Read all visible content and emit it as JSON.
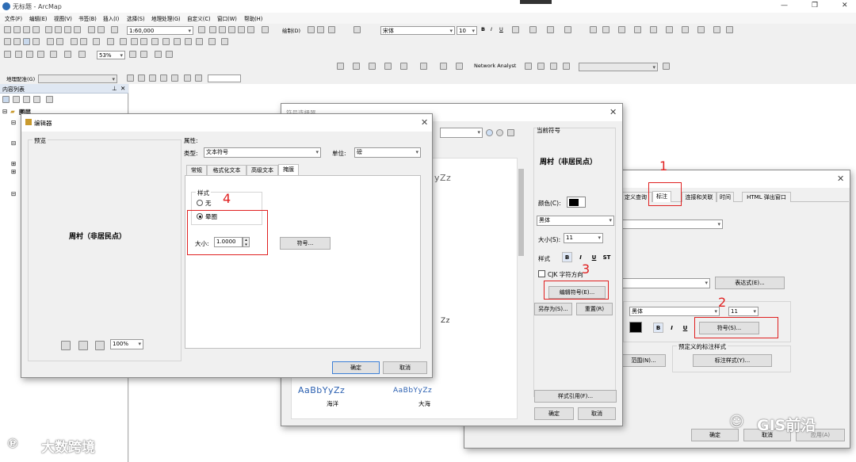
{
  "app": {
    "title": "无标题 - ArcMap",
    "minimize_icon": "minimize-icon",
    "maximize_icon": "maximize-icon",
    "close_icon": "close-icon"
  },
  "menu": [
    "文件(F)",
    "编辑(E)",
    "视图(V)",
    "书签(B)",
    "插入(I)",
    "选择(S)",
    "地理处理(G)",
    "自定义(C)",
    "窗口(W)",
    "帮助(H)"
  ],
  "toolbar": {
    "scale": "1:60,000",
    "draw_label": "绘制(D)",
    "font_name": "宋体",
    "font_size": "10",
    "zoom_pct": "53%",
    "network_analyst": "Network Analyst",
    "georef": "地理配准(G)"
  },
  "toc": {
    "title": "内容列表",
    "layers_label": "图层"
  },
  "symbol_selector": {
    "title": "符号选择器",
    "current_symbol_label": "当前符号",
    "preview_text": "周村（非居民点）",
    "color_label": "颜色(C):",
    "font_name": "黑体",
    "size_label": "大小(S):",
    "size_value": "11",
    "style_label": "样式",
    "bold": "B",
    "italic": "I",
    "underline": "U",
    "strike": "ST",
    "cjk_label": "CJK 字符方向",
    "edit_symbol_btn": "编辑符号(E)...",
    "save_as_btn": "另存为(S)...",
    "reset_btn": "重置(R)",
    "style_ref_btn": "样式引用(F)...",
    "ok_btn": "确定",
    "cancel_btn": "取消",
    "samples": [
      {
        "text": "AaBbYyZz",
        "name": "海洋"
      },
      {
        "text": "AaBbYyZz",
        "name": "大海"
      }
    ],
    "partial_samples": [
      "yZz",
      "Zz"
    ]
  },
  "layer_props": {
    "tabs": [
      "定义查询",
      "标注",
      "连接和关联",
      "时间",
      "HTML 弹出窗口"
    ],
    "expression_btn": "表达式(E)...",
    "font_name": "黑体",
    "font_size": "11",
    "symbol_btn": "符号(S)...",
    "predefined_label": "预定义的标注样式",
    "label_style_btn": "标注样式(Y)...",
    "range_btn": "范围(N)...",
    "ok_btn": "确定",
    "cancel_btn": "取消",
    "apply_btn": "应用(A)"
  },
  "editor": {
    "title": "编辑器",
    "preview_label": "预览",
    "preview_text": "周村（非居民点）",
    "props_label": "属性:",
    "type_label": "类型:",
    "type_value": "文本符号",
    "unit_label": "单位:",
    "unit_value": "磅",
    "tabs": [
      "常规",
      "格式化文本",
      "高级文本",
      "掩膜"
    ],
    "style_group": "样式",
    "radio_none": "无",
    "radio_halo": "晕圈",
    "size_label": "大小:",
    "size_value": "1.0000",
    "symbol_btn": "符号...",
    "zoom": "100%",
    "ok_btn": "确定",
    "cancel_btn": "取消"
  },
  "annotations": [
    "1",
    "2",
    "3",
    "4"
  ],
  "watermarks": {
    "left": "大数跨境",
    "right": "GIS前沿"
  },
  "colors": {
    "annotation_red": "#e02020",
    "sample_blue": "#2a5fb0"
  }
}
